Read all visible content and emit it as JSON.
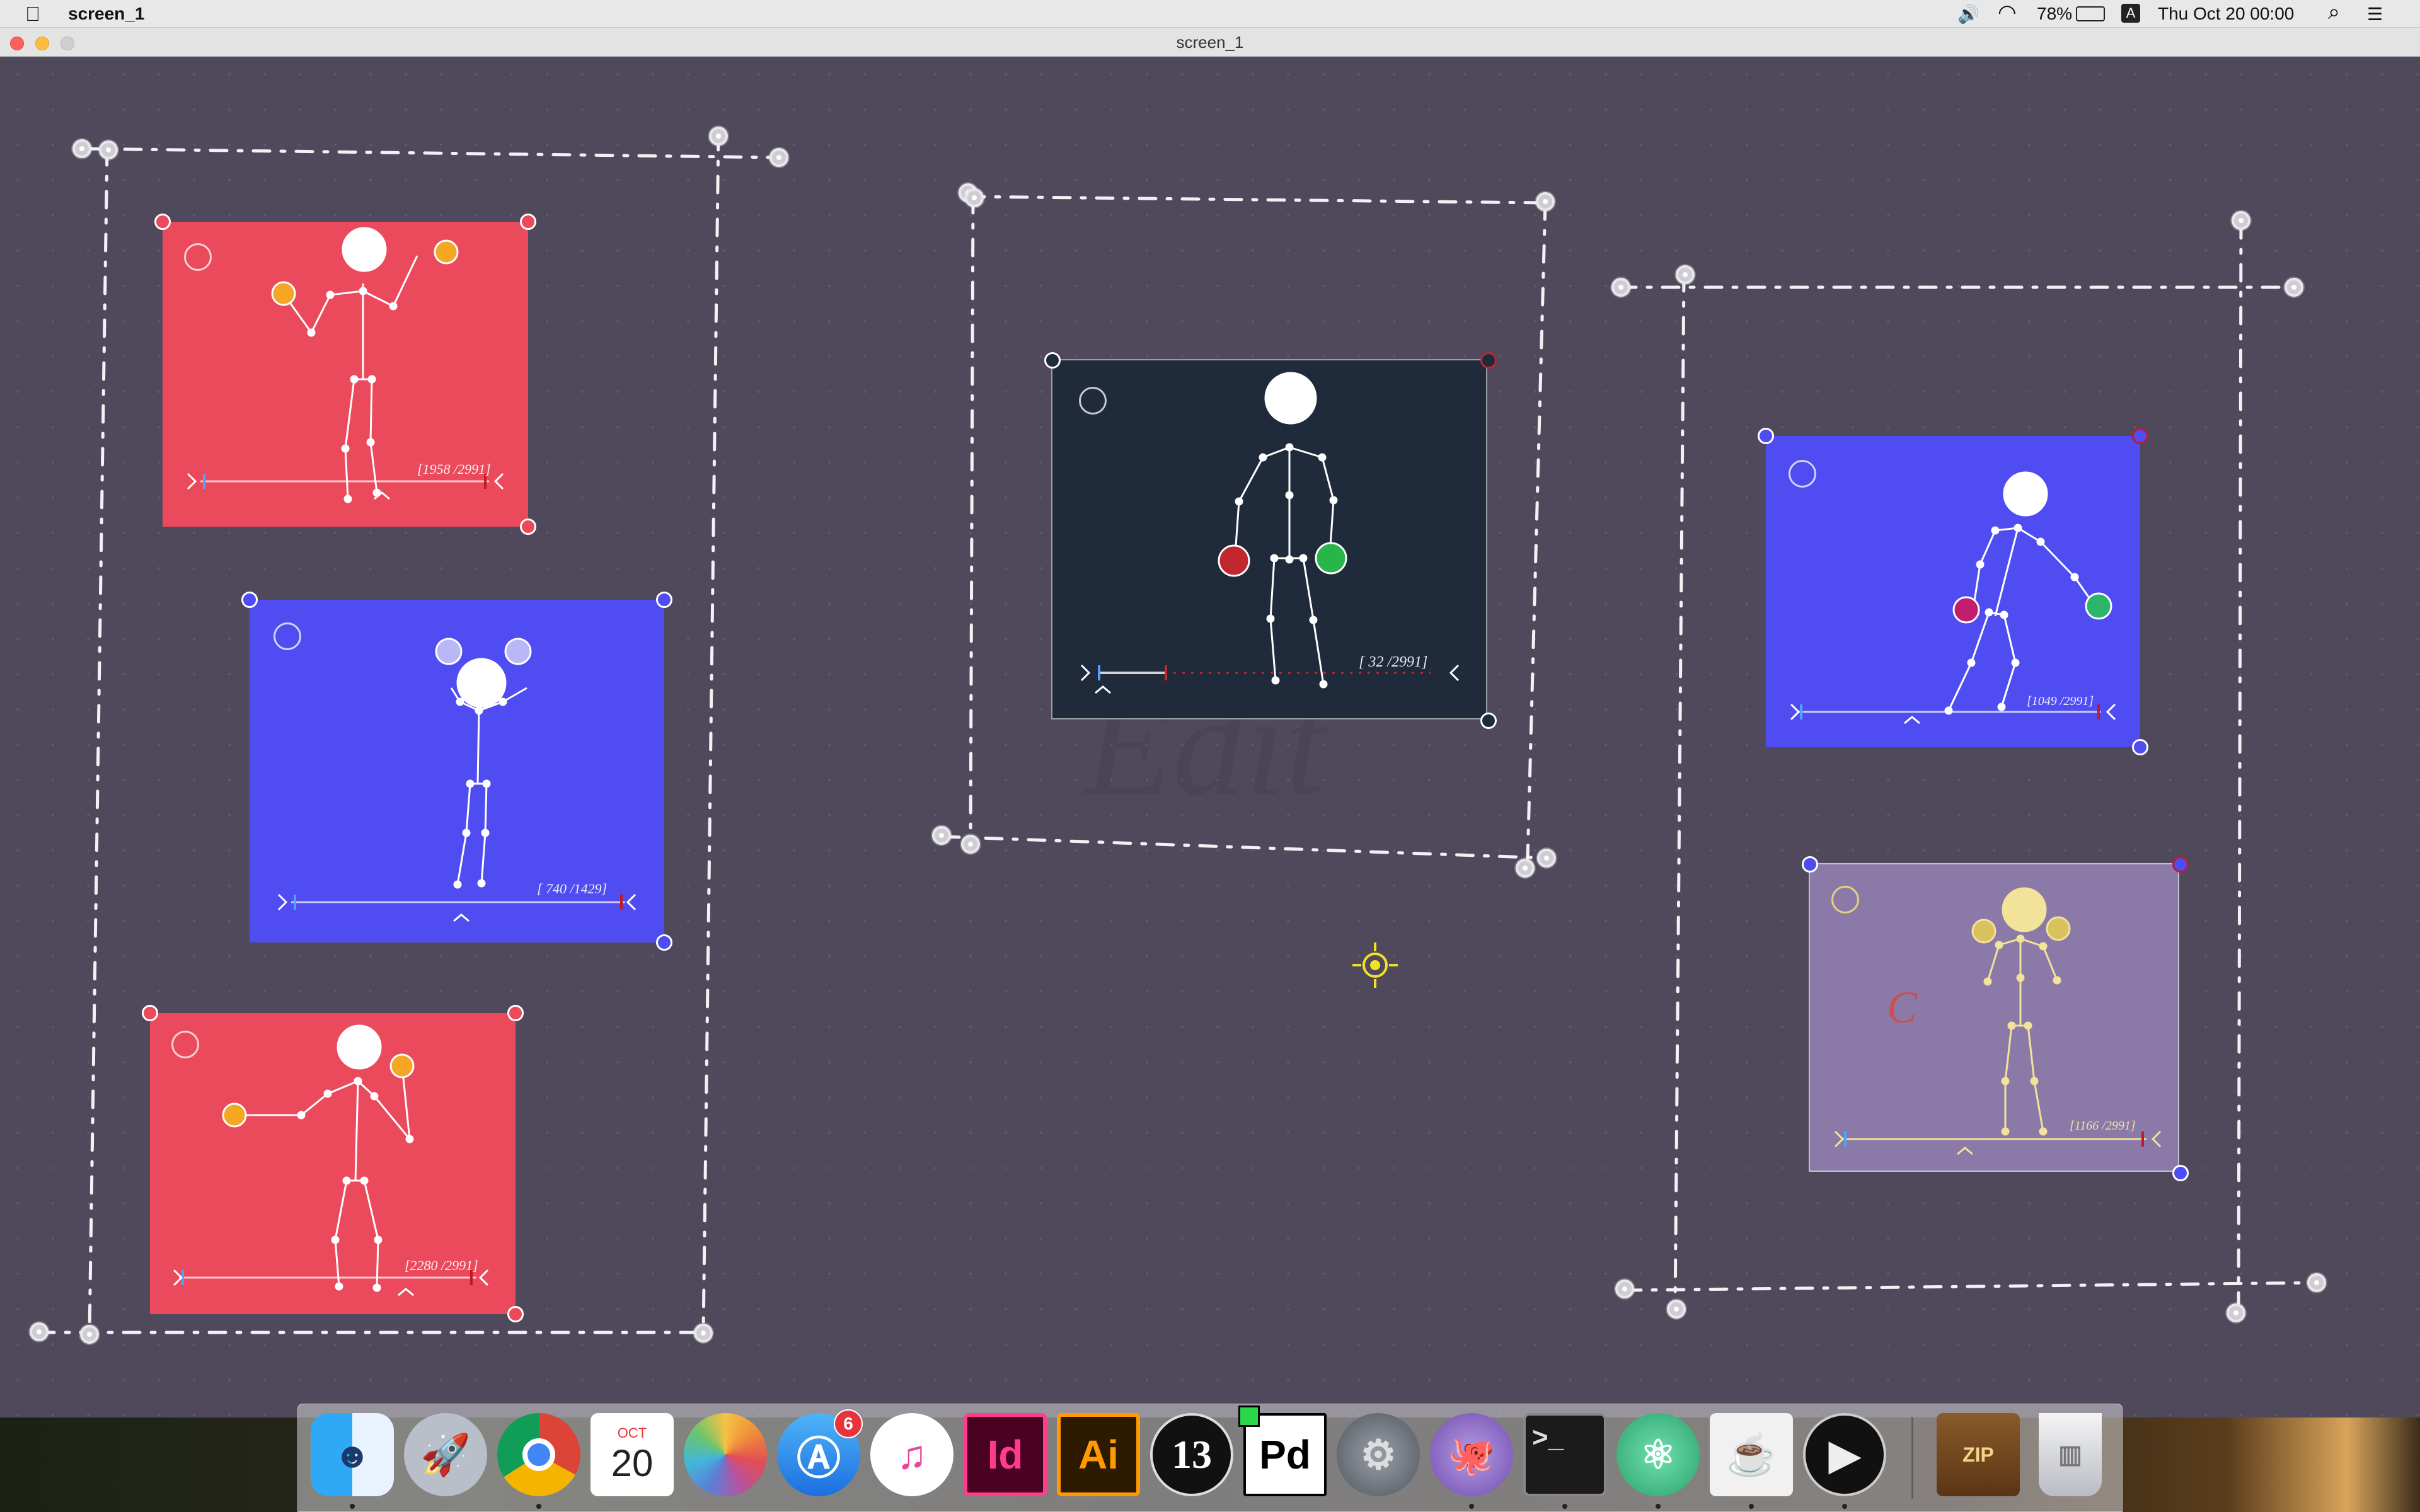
{
  "menubar": {
    "apple_glyph": "",
    "app_name": "screen_1",
    "volume_glyph": "🔊",
    "wifi_glyph": "◠",
    "battery_percent": "78%",
    "input_badge": "A",
    "datetime": "Thu Oct 20  00:00",
    "search_glyph": "⌕",
    "list_glyph": "☰"
  },
  "window": {
    "title": "screen_1"
  },
  "canvas": {
    "watermark": "Edit",
    "purple_card_letter": "C"
  },
  "cards": [
    {
      "id": "red-1",
      "counter": "[1958 /2991]",
      "bg": "#ea4a5c",
      "corner": "#ea4a5c",
      "accent": "#f5a623"
    },
    {
      "id": "blue-1",
      "counter": "[  740 /1429]",
      "bg": "#4f4cf2",
      "corner": "#4f4cf2",
      "accent": "#b9b7f8"
    },
    {
      "id": "red-2",
      "counter": "[2280 /2991]",
      "bg": "#ea4a5c",
      "corner": "#ea4a5c",
      "accent": "#f5a623"
    },
    {
      "id": "dark-1",
      "counter": "[  32 /2991]",
      "bg": "#1f2a3b",
      "corner": "#1f2a3b",
      "accent_left": "#c2262f",
      "accent_right": "#28b54a"
    },
    {
      "id": "blue-2",
      "counter": "[1049 /2991]",
      "bg": "#4f4cf2",
      "corner": "#4f4cf2",
      "accent_left": "#c21e6e",
      "accent_right": "#2bb56a"
    },
    {
      "id": "purple-1",
      "counter": "[1166 /2991]",
      "bg": "#8b7aa8",
      "corner": "#4f4cf2",
      "accent": "#e6d27a"
    }
  ],
  "dock": {
    "items": [
      {
        "name": "finder",
        "label": ""
      },
      {
        "name": "launchpad",
        "label": ""
      },
      {
        "name": "chrome",
        "label": ""
      },
      {
        "name": "calendar",
        "label": "20",
        "sub": "OCT"
      },
      {
        "name": "photos",
        "label": ""
      },
      {
        "name": "app-store",
        "label": "",
        "badge": "6"
      },
      {
        "name": "itunes",
        "label": "♫"
      },
      {
        "name": "indesign",
        "label": "Id"
      },
      {
        "name": "illustrator",
        "label": "Ai"
      },
      {
        "name": "processing-13",
        "label": "13"
      },
      {
        "name": "pure-data",
        "label": "Pd"
      },
      {
        "name": "system-preferences",
        "label": "⚙"
      },
      {
        "name": "github-desktop",
        "label": ""
      },
      {
        "name": "terminal",
        "label": ">_"
      },
      {
        "name": "atom",
        "label": "⚛"
      },
      {
        "name": "java",
        "label": "☕"
      },
      {
        "name": "media-player",
        "label": "▶"
      },
      {
        "name": "archive-utility",
        "label": "ZIP"
      },
      {
        "name": "trash",
        "label": ""
      }
    ]
  }
}
